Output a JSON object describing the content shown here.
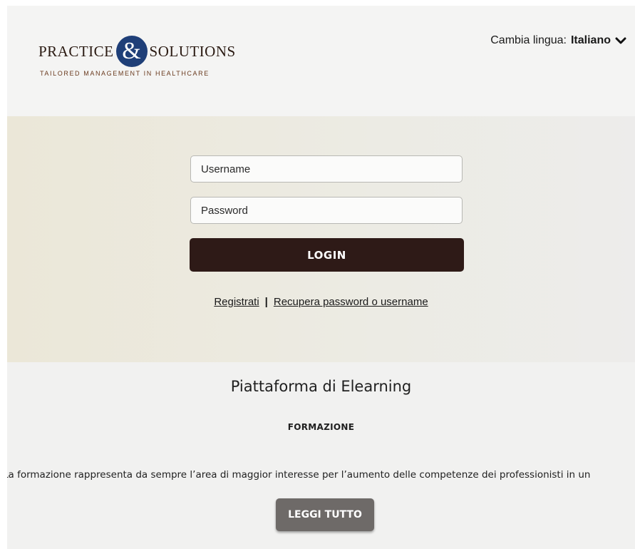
{
  "header": {
    "logo": {
      "word_left": "Practice",
      "ampersand": "&",
      "word_right": "Solutions",
      "tagline": "TAILORED MANAGEMENT IN HEALTHCARE"
    },
    "language": {
      "label": "Cambia lingua:",
      "selected": "Italiano"
    }
  },
  "login": {
    "username_placeholder": "Username",
    "password_placeholder": "Password",
    "login_button": "LOGIN",
    "register_link": "Registrati",
    "separator": "|",
    "recover_link": "Recupera password o username"
  },
  "content": {
    "title": "Piattaforma di Elearning",
    "subtitle": "FORMAZIONE",
    "excerpt": "La formazione rappresenta da sempre l’area di maggior interesse per l’aumento delle competenze dei professionisti in un",
    "read_more_button": "LEGGI TUTTO"
  },
  "colors": {
    "login_button": "#2e1a17",
    "read_more_button": "#6e6a68",
    "logo_circle": "#1f3f78",
    "login_band": "#ebe7d8"
  },
  "icons": {
    "language_dropdown": "chevron-down-icon"
  }
}
